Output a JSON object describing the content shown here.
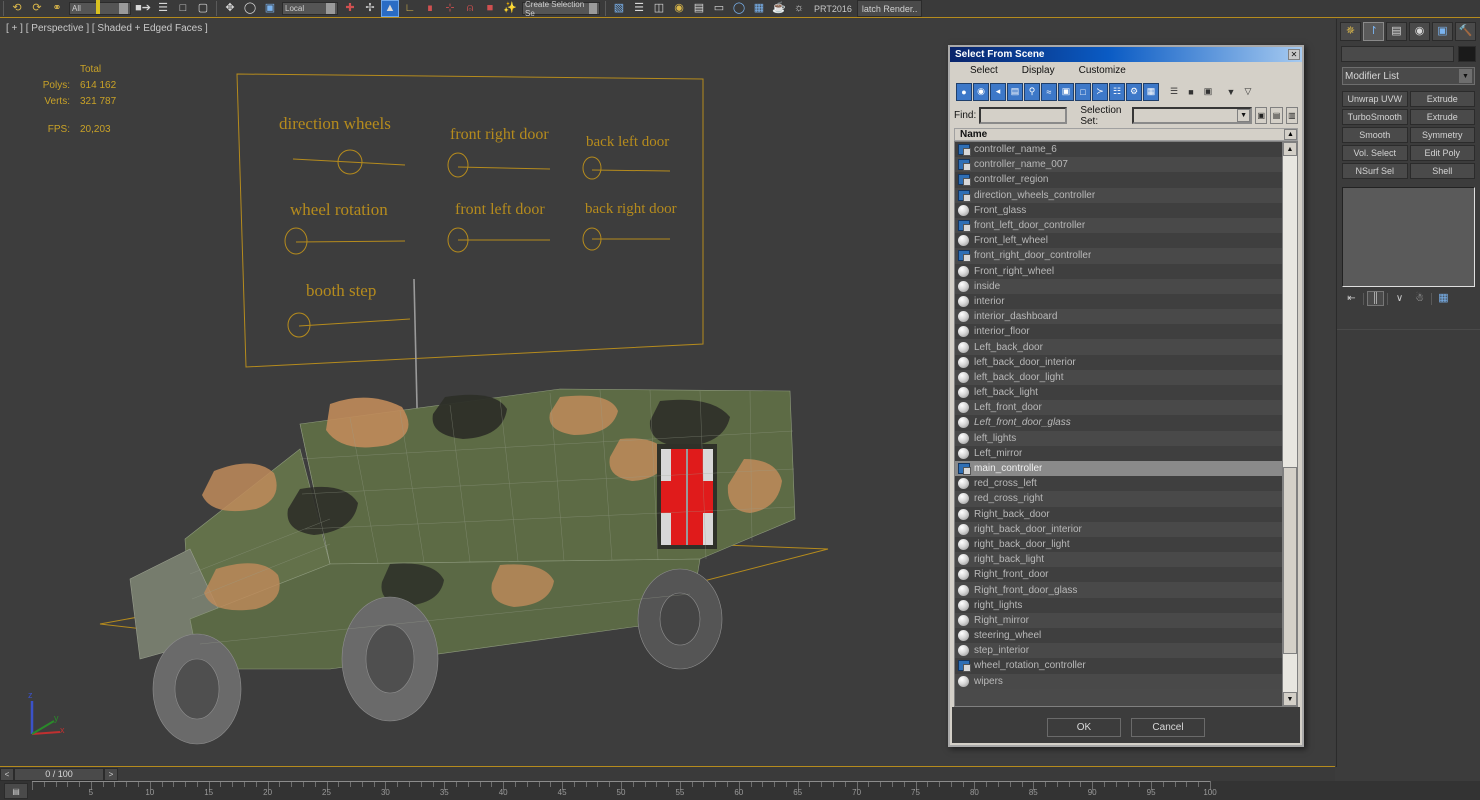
{
  "app": {
    "viewport_label": "[ + ] [ Perspective ] [ Shaded + Edged Faces ]",
    "stats": {
      "total_header": "Total",
      "polys_label": "Polys:",
      "polys_value": "614 162",
      "verts_label": "Verts:",
      "verts_value": "321 787",
      "fps_label": "FPS:",
      "fps_value": "20,203"
    },
    "axis": {
      "x": "x",
      "y": "y",
      "z": "z"
    }
  },
  "toolbar": {
    "coord_field_value": "Local",
    "selection_set_value": "Create Selection Se",
    "named_field_value": "All",
    "plugin_label": "PRT2016",
    "batch_render_label": "latch Render..",
    "icons": [
      "undo-icon",
      "redo-icon",
      "link-icon",
      "unlink-icon",
      "bind-space-warp-icon",
      "select-filter-icon",
      "select-object-icon",
      "select-by-name-icon",
      "rect-select-region-icon",
      "window-crossing-icon",
      "select-move-icon",
      "select-rotate-icon",
      "select-scale-icon",
      "ref-coord-icon",
      "use-pivot-center-icon",
      "select-and-manipulate-icon",
      "snap-toggle-icon",
      "angle-snap-icon",
      "percent-snap-icon",
      "spinner-snap-icon",
      "named-selection-icon",
      "mirror-icon",
      "align-icon",
      "layer-manager-icon",
      "graph-editor-icon",
      "schematic-view-icon",
      "material-editor-icon",
      "render-setup-icon",
      "render-frame-icon",
      "render-production-icon"
    ]
  },
  "viewport_annotations": [
    {
      "label": "direction wheels"
    },
    {
      "label": "front right door"
    },
    {
      "label": "back left door"
    },
    {
      "label": "wheel rotation"
    },
    {
      "label": "front left door"
    },
    {
      "label": "back right door"
    },
    {
      "label": "booth step"
    }
  ],
  "timeline": {
    "prev_label": "<",
    "next_label": ">",
    "current_frame": "0 / 100",
    "tick_labels": [
      "5",
      "10",
      "15",
      "20",
      "25",
      "30",
      "35",
      "40",
      "45",
      "50",
      "55",
      "60",
      "65",
      "70",
      "75",
      "80",
      "85",
      "90",
      "95",
      "100"
    ],
    "range_start": 0,
    "range_end": 100
  },
  "command_panel": {
    "tabs": [
      {
        "name": "create-tab",
        "icon": "star-icon",
        "active": false
      },
      {
        "name": "modify-tab",
        "icon": "arc-icon",
        "active": true
      },
      {
        "name": "hierarchy-tab",
        "icon": "hierarchy-icon",
        "active": false
      },
      {
        "name": "motion-tab",
        "icon": "wheel-icon",
        "active": false
      },
      {
        "name": "display-tab",
        "icon": "monitor-icon",
        "active": false
      },
      {
        "name": "utilities-tab",
        "icon": "hammer-icon",
        "active": false
      }
    ],
    "object_name": "",
    "object_color": "#1a1a1a",
    "modifier_list_label": "Modifier List",
    "modifier_buttons": [
      "Unwrap UVW",
      "Extrude",
      "TurboSmooth",
      "Extrude",
      "Smooth",
      "Symmetry",
      "Vol. Select",
      "Edit Poly",
      "NSurf Sel",
      "Shell"
    ],
    "stack_icons": [
      "pin-stack-icon",
      "show-end-result-icon",
      "make-unique-icon",
      "remove-modifier-icon",
      "configure-sets-icon"
    ]
  },
  "dialog": {
    "title": "Select From Scene",
    "close_label": "✕",
    "menu": [
      "Select",
      "Display",
      "Customize"
    ],
    "toolbar_icons": [
      "display-geometry-icon",
      "display-shapes-icon",
      "display-lights-icon",
      "display-cameras-icon",
      "display-helpers-icon",
      "display-space-warps-icon",
      "display-groups-icon",
      "display-xrefs-icon",
      "display-bones-icon",
      "display-containers-icon",
      "display-particles-icon",
      "display-ik-icon",
      "list-types-icon",
      "display-children-icon",
      "display-influences-icon",
      "filter-icon",
      "advanced-filter-icon"
    ],
    "find_label": "Find:",
    "find_value": "",
    "selection_set_label": "Selection Set:",
    "selection_set_value": "",
    "column_header": "Name",
    "ok_label": "OK",
    "cancel_label": "Cancel",
    "items": [
      {
        "name": "controller_name_6",
        "type": "controller",
        "selected": false,
        "italic": false
      },
      {
        "name": "controller_name_007",
        "type": "controller",
        "selected": false,
        "italic": false
      },
      {
        "name": "controller_region",
        "type": "controller",
        "selected": false,
        "italic": false
      },
      {
        "name": "direction_wheels_controller",
        "type": "controller",
        "selected": false,
        "italic": false
      },
      {
        "name": "Front_glass",
        "type": "geometry",
        "selected": false,
        "italic": false
      },
      {
        "name": "front_left_door_controller",
        "type": "controller",
        "selected": false,
        "italic": false
      },
      {
        "name": "Front_left_wheel",
        "type": "geometry",
        "selected": false,
        "italic": false
      },
      {
        "name": "front_right_door_controller",
        "type": "controller",
        "selected": false,
        "italic": false
      },
      {
        "name": "Front_right_wheel",
        "type": "geometry",
        "selected": false,
        "italic": false
      },
      {
        "name": "inside",
        "type": "geometry",
        "selected": false,
        "italic": false
      },
      {
        "name": "interior",
        "type": "geometry",
        "selected": false,
        "italic": false
      },
      {
        "name": "interior_dashboard",
        "type": "geometry",
        "selected": false,
        "italic": false
      },
      {
        "name": "interior_floor",
        "type": "geometry",
        "selected": false,
        "italic": false
      },
      {
        "name": "Left_back_door",
        "type": "geometry",
        "selected": false,
        "italic": false
      },
      {
        "name": "left_back_door_interior",
        "type": "geometry",
        "selected": false,
        "italic": false
      },
      {
        "name": "left_back_door_light",
        "type": "geometry",
        "selected": false,
        "italic": false
      },
      {
        "name": "left_back_light",
        "type": "geometry",
        "selected": false,
        "italic": false
      },
      {
        "name": "Left_front_door",
        "type": "geometry",
        "selected": false,
        "italic": false
      },
      {
        "name": "Left_front_door_glass",
        "type": "geometry",
        "selected": false,
        "italic": true
      },
      {
        "name": "left_lights",
        "type": "geometry",
        "selected": false,
        "italic": false
      },
      {
        "name": "Left_mirror",
        "type": "geometry",
        "selected": false,
        "italic": false
      },
      {
        "name": "main_controller",
        "type": "controller",
        "selected": true,
        "italic": false
      },
      {
        "name": "red_cross_left",
        "type": "geometry",
        "selected": false,
        "italic": false
      },
      {
        "name": "red_cross_right",
        "type": "geometry",
        "selected": false,
        "italic": false
      },
      {
        "name": "Right_back_door",
        "type": "geometry",
        "selected": false,
        "italic": false
      },
      {
        "name": "right_back_door_interior",
        "type": "geometry",
        "selected": false,
        "italic": false
      },
      {
        "name": "right_back_door_light",
        "type": "geometry",
        "selected": false,
        "italic": false
      },
      {
        "name": "right_back_light",
        "type": "geometry",
        "selected": false,
        "italic": false
      },
      {
        "name": "Right_front_door",
        "type": "geometry",
        "selected": false,
        "italic": false
      },
      {
        "name": "Right_front_door_glass",
        "type": "geometry",
        "selected": false,
        "italic": false
      },
      {
        "name": "right_lights",
        "type": "geometry",
        "selected": false,
        "italic": false
      },
      {
        "name": "Right_mirror",
        "type": "geometry",
        "selected": false,
        "italic": false
      },
      {
        "name": "steering_wheel",
        "type": "geometry",
        "selected": false,
        "italic": false
      },
      {
        "name": "step_interior",
        "type": "geometry",
        "selected": false,
        "italic": false
      },
      {
        "name": "wheel_rotation_controller",
        "type": "controller",
        "selected": false,
        "italic": false
      },
      {
        "name": "wipers",
        "type": "geometry",
        "selected": false,
        "italic": false
      }
    ]
  },
  "colors": {
    "viewport_bg": "#3d3d3d",
    "annotation": "#b58b1d",
    "stats_text": "#c9a227",
    "dialog_face": "#d4d0c8",
    "title_gradient_start": "#0a246a",
    "title_gradient_end": "#a6caf0",
    "selection_row": "#8a8a8a",
    "red_cross": "#e01b1b"
  }
}
